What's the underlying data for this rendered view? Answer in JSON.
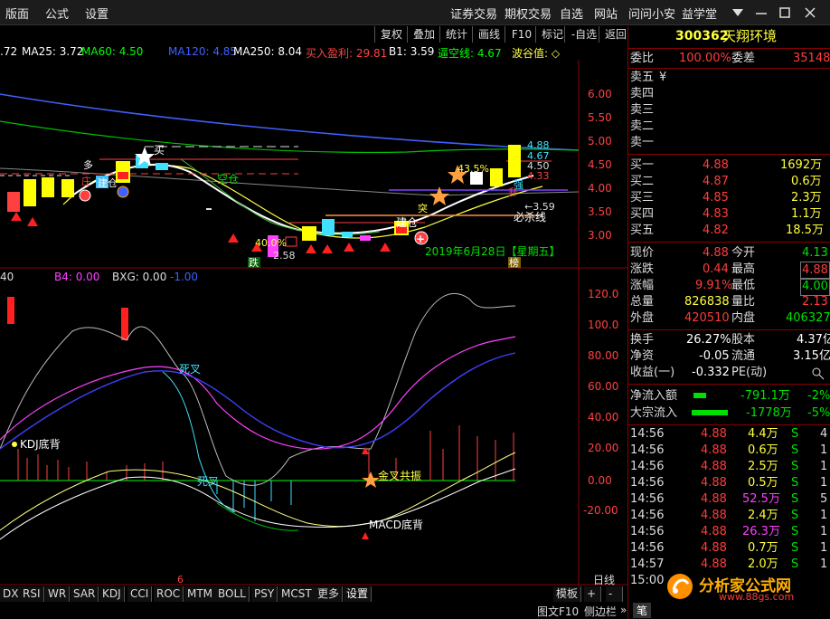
{
  "menu": {
    "left": [
      "版面",
      "公式",
      "设置"
    ],
    "right": [
      "证券交易",
      "期权交易",
      "自选",
      "网站",
      "问问小安",
      "益学堂"
    ],
    "window_controls": [
      "minimize-icon",
      "restore-icon",
      "close-icon"
    ]
  },
  "toolbar": [
    "复权",
    "叠加",
    "统计",
    "画线",
    "F10",
    "标记",
    "-自选",
    "返回"
  ],
  "ma_bar": {
    "items": [
      {
        "text": ".72",
        "color": "#ffffff"
      },
      {
        "text": "MA25: 3.72",
        "color": "#ffffff"
      },
      {
        "text": "MA60: 4.50",
        "color": "#00ff00"
      },
      {
        "text": "MA120: 4.85",
        "color": "#4060ff"
      },
      {
        "text": "MA250: 8.04",
        "color": "#ffffff"
      },
      {
        "text": "买入盈利: 29.81",
        "color": "#ff4040"
      },
      {
        "text": "B1: 3.59",
        "color": "#ffffff"
      },
      {
        "text": "逼空线: 4.67",
        "color": "#00ff00"
      },
      {
        "text": "波谷值: ◇",
        "color": "#ffff40"
      }
    ]
  },
  "price_axis": [
    "6.00",
    "5.50",
    "5.00",
    "4.50",
    "4.00",
    "3.50",
    "3.00"
  ],
  "indicator_axis": [
    "120.0",
    "100.0",
    "80.00",
    "60.00",
    "40.00",
    "20.00",
    "0.00",
    "-20.00"
  ],
  "main_labels": {
    "p488": "4.88",
    "p467": "4.67",
    "p450": "4.50",
    "p433": "4.33",
    "p359": "←3.59",
    "p258": "2.58",
    "pct": "43.5%",
    "pct2": "40.0%",
    "date": "2019年6月28日【星期五】",
    "bisha": "必杀线",
    "duo": "多",
    "jiancang": "建仓",
    "jiancang2": "建仓",
    "kongcang": "空仓",
    "kaishi": "买",
    "die": "跌",
    "bang": "榜",
    "qiang": "强",
    "tupo": "突",
    "zhuangx": "庄",
    "shengzhu": "升"
  },
  "indicator_header": {
    "left": "40",
    "b4": "B4: 0.00",
    "bxg": "BXG: 0.00",
    "last": "-1.00"
  },
  "indicator_labels": {
    "sicha": "死叉",
    "sicha2": "死叉",
    "kdj": "KDJ底背",
    "jincha": "金叉共振",
    "macd": "MACD底背",
    "six": "6"
  },
  "tabs": [
    "DX",
    "RSI",
    "WR",
    "SAR",
    "KDJ",
    "CCI",
    "ROC",
    "MTM",
    "BOLL",
    "PSY",
    "MCST",
    "更多",
    "设置"
  ],
  "tabs_right": {
    "muban": "模板",
    "plus": "+",
    "minus": "-",
    "rixian": "日线"
  },
  "footer": {
    "f10": "图文F10",
    "side": "侧边栏",
    "arrow": "»",
    "bi": "笔"
  },
  "stock": {
    "code": "300362",
    "name": "天翔环境"
  },
  "weibi": {
    "label": "委比",
    "value": "100.00%",
    "label2": "委差",
    "value2": "35148"
  },
  "sell": [
    {
      "label": "卖五",
      "price": "¥",
      "vol": ""
    },
    {
      "label": "卖四",
      "price": "",
      "vol": ""
    },
    {
      "label": "卖三",
      "price": "",
      "vol": ""
    },
    {
      "label": "卖二",
      "price": "",
      "vol": ""
    },
    {
      "label": "卖一",
      "price": "",
      "vol": ""
    }
  ],
  "buy": [
    {
      "label": "买一",
      "price": "4.88",
      "vol": "1692万"
    },
    {
      "label": "买二",
      "price": "4.87",
      "vol": "0.6万"
    },
    {
      "label": "买三",
      "price": "4.85",
      "vol": "2.3万"
    },
    {
      "label": "买四",
      "price": "4.83",
      "vol": "1.1万"
    },
    {
      "label": "买五",
      "price": "4.82",
      "vol": "18.5万"
    }
  ],
  "quote": [
    {
      "l1": "现价",
      "v1": "4.88",
      "c1": "red",
      "l2": "今开",
      "v2": "4.13",
      "c2": "green",
      "b2": false
    },
    {
      "l1": "涨跌",
      "v1": "0.44",
      "c1": "red",
      "l2": "最高",
      "v2": "4.88",
      "c2": "red",
      "b2": true
    },
    {
      "l1": "涨幅",
      "v1": "9.91%",
      "c1": "red",
      "l2": "最低",
      "v2": "4.00",
      "c2": "green",
      "b2": true
    },
    {
      "l1": "总量",
      "v1": "826838",
      "c1": "yellow",
      "l2": "量比",
      "v2": "2.13",
      "c2": "red",
      "b2": false
    },
    {
      "l1": "外盘",
      "v1": "420510",
      "c1": "red",
      "l2": "内盘",
      "v2": "406327",
      "c2": "green",
      "b2": false
    }
  ],
  "fin": [
    {
      "l1": "换手",
      "v1": "26.27%",
      "l2": "股本",
      "v2": "4.37亿"
    },
    {
      "l1": "净资",
      "v1": "-0.05",
      "l2": "流通",
      "v2": "3.15亿"
    },
    {
      "l1": "收益(一)",
      "v1": "-0.332",
      "l2": "PE(动)",
      "v2": ""
    }
  ],
  "flow": [
    {
      "label": "净流入额",
      "value": "-791.1万",
      "pct": "-2%"
    },
    {
      "label": "大宗流入",
      "value": "-1778万",
      "pct": "-5%"
    }
  ],
  "ticks": [
    {
      "t": "14:56",
      "p": "4.88",
      "v": "4.4万",
      "s": "S",
      "n": "4",
      "vc": "yellow"
    },
    {
      "t": "14:56",
      "p": "4.88",
      "v": "0.6万",
      "s": "S",
      "n": "1",
      "vc": "yellow"
    },
    {
      "t": "14:56",
      "p": "4.88",
      "v": "2.5万",
      "s": "S",
      "n": "1",
      "vc": "yellow"
    },
    {
      "t": "14:56",
      "p": "4.88",
      "v": "0.5万",
      "s": "S",
      "n": "1",
      "vc": "yellow"
    },
    {
      "t": "14:56",
      "p": "4.88",
      "v": "52.5万",
      "s": "S",
      "n": "5",
      "vc": "magenta"
    },
    {
      "t": "14:56",
      "p": "4.88",
      "v": "2.4万",
      "s": "S",
      "n": "1",
      "vc": "yellow"
    },
    {
      "t": "14:56",
      "p": "4.88",
      "v": "26.3万",
      "s": "S",
      "n": "1",
      "vc": "magenta"
    },
    {
      "t": "14:56",
      "p": "4.88",
      "v": "0.7万",
      "s": "S",
      "n": "1",
      "vc": "yellow"
    },
    {
      "t": "14:57",
      "p": "4.88",
      "v": "2.0万",
      "s": "S",
      "n": "1",
      "vc": "yellow"
    },
    {
      "t": "15:00",
      "p": "",
      "v": "",
      "s": "",
      "n": "",
      "vc": "yellow"
    }
  ],
  "watermark": {
    "text": "分析家公式网",
    "url": "www.88gs.com"
  }
}
